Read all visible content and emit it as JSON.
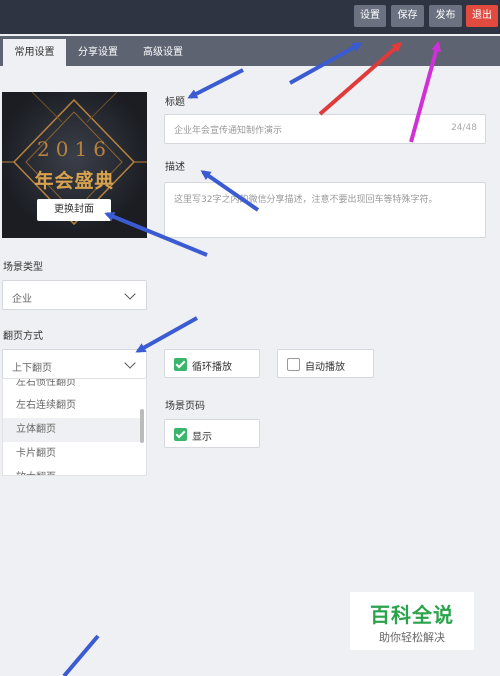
{
  "toolbar": {
    "settings_label": "设置",
    "save_label": "保存",
    "publish_label": "发布",
    "exit_label": "退出"
  },
  "tabs": [
    {
      "label": "常用设置",
      "active": true
    },
    {
      "label": "分享设置",
      "active": false
    },
    {
      "label": "高级设置",
      "active": false
    }
  ],
  "cover": {
    "year": "2016",
    "title": "年会盛典",
    "change_button": "更换封面"
  },
  "title_field": {
    "label": "标题",
    "placeholder": "企业年会宣传通知制作演示",
    "counter": "24/48"
  },
  "description_field": {
    "label": "描述",
    "placeholder": "这里写32字之内的微信分享描述，注意不要出现回车等特殊字符。"
  },
  "scene_type": {
    "label": "场景类型",
    "value": "企业"
  },
  "page_turn": {
    "label": "翻页方式",
    "value": "上下翻页",
    "options": [
      "左右惯性翻页",
      "左右连续翻页",
      "立体翻页",
      "卡片翻页",
      "放大翻页"
    ],
    "highlighted_index": 2
  },
  "options": {
    "loop_label": "循环播放",
    "loop_checked": true,
    "autoplay_label": "自动播放",
    "autoplay_checked": false
  },
  "page_number": {
    "label": "场景页码",
    "show_label": "显示",
    "checked": true
  },
  "watermark": {
    "title": "百科全说",
    "subtitle": "助你轻松解决"
  },
  "colors": {
    "topbar": "#2e3441",
    "tabs_bar": "#5d6371",
    "exit_button": "#e04a3f",
    "checkbox_on": "#3ab56b",
    "arrow_blue": "#3a5bd1",
    "arrow_red": "#e03a3a",
    "arrow_magenta": "#d12fd8",
    "watermark_green": "#2ba24c"
  }
}
